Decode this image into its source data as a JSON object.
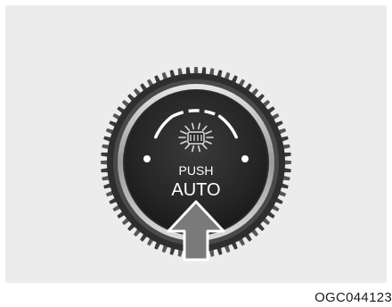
{
  "knob": {
    "line1": "PUSH",
    "line2": "AUTO",
    "icon": "defrost-snowflake-icon",
    "arrow_icon": "press-up-arrow-icon"
  },
  "figure_code": "OGC044123"
}
